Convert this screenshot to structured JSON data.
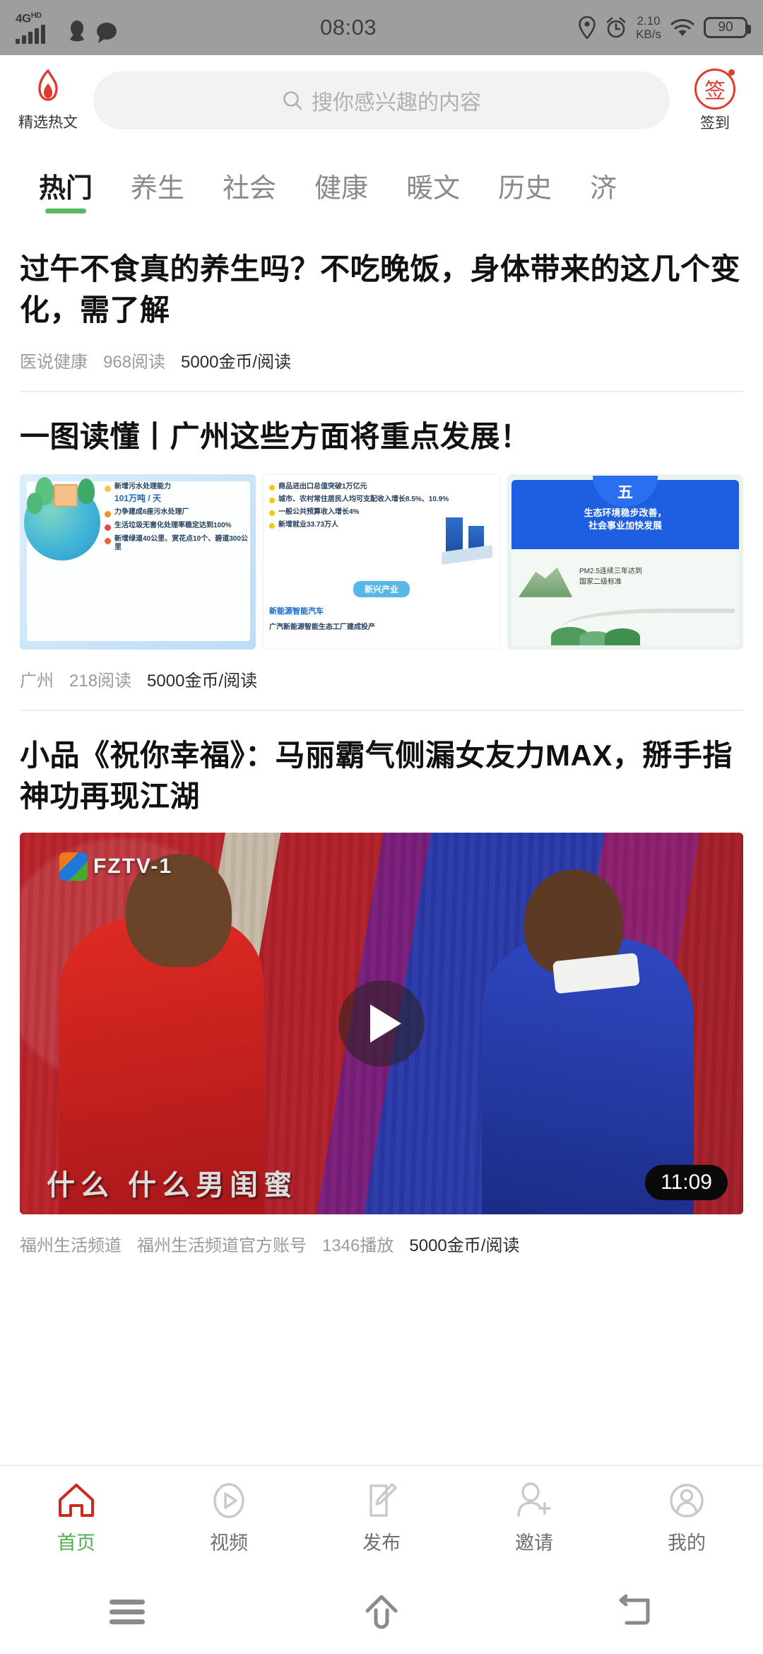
{
  "status_bar": {
    "network_type": "4G",
    "network_suffix": "HD",
    "signal_icon": "signal-bars-icon",
    "notification_icons": [
      "qq-penguin-icon",
      "message-bubble-icon"
    ],
    "time": "08:03",
    "location_icon": "location-pin-icon",
    "alarm_icon": "alarm-clock-icon",
    "net_speed_value": "2.10",
    "net_speed_unit": "KB/s",
    "wifi_icon": "wifi-icon",
    "battery_level": "90"
  },
  "app_header": {
    "hot_entry": {
      "icon": "flame-icon",
      "label": "精选热文"
    },
    "search": {
      "icon": "search-icon",
      "placeholder": "搜你感兴趣的内容",
      "value": ""
    },
    "sign_entry": {
      "icon": "sign-stamp-icon",
      "badge_text": "签",
      "label": "签到"
    }
  },
  "category_tabs": {
    "active_index": 0,
    "items": [
      {
        "label": "热门"
      },
      {
        "label": "养生"
      },
      {
        "label": "社会"
      },
      {
        "label": "健康"
      },
      {
        "label": "暖文"
      },
      {
        "label": "历史"
      },
      {
        "label": "济"
      }
    ],
    "indicator_color": "#5cb860"
  },
  "feed": {
    "articles": [
      {
        "title": "过午不食真的养生吗？不吃晚饭，身体带来的这几个变化，需了解",
        "source": "医说健康",
        "reads": "968阅读",
        "coin": "5000金币/阅读",
        "layout": "text-only"
      },
      {
        "title": "一图读懂丨广州这些方面将重点发展！",
        "source": "广州",
        "reads": "218阅读",
        "coin": "5000金币/阅读",
        "layout": "three-images",
        "images": [
          {
            "name": "infographic-environment",
            "bullets": [
              {
                "text_prefix": "新增污水处理能力",
                "highlight": "101万吨 / 天",
                "dot": "#f6c343"
              },
              {
                "text_prefix": "力争建成6座污水处理厂",
                "highlight": "",
                "dot": "#f0912d"
              },
              {
                "text_prefix": "生活垃圾无害化处理率稳定达到100%",
                "highlight": "",
                "dot": "#e8484b"
              },
              {
                "text_prefix": "新增绿道40公里、赏花点10个、碧道300公里",
                "highlight": "",
                "dot": "#ef6233"
              }
            ]
          },
          {
            "name": "infographic-economy",
            "bullets": [
              "商品进出口总值突破1万亿元",
              "城市、农村常住居民人均可支配收入增长8.5%、10.9%",
              "一般公共预算收入增长4%",
              "新增就业33.73万人"
            ],
            "section_pill": "新兴产业",
            "sub_heading": "新能源智能汽车",
            "sub_bullet": "广汽新能源智能生态工厂建成投产"
          },
          {
            "name": "infographic-ecology",
            "chapter_number": "五",
            "headline_line1": "生态环境稳步改善，",
            "headline_line2": "社会事业加快发展",
            "body_line1": "PM2.5连续三年达到",
            "body_line2": "国家二级标准"
          }
        ]
      },
      {
        "title": "小品《祝你幸福》：马丽霸气侧漏女友力MAX，掰手指神功再现江湖",
        "source": "福州生活频道",
        "account": "福州生活频道官方账号",
        "plays": "1346播放",
        "coin": "5000金币/阅读",
        "layout": "video",
        "video": {
          "channel_watermark": "FZTV-1",
          "burned_subtitle": "什么 什么男闺蜜",
          "duration": "11:09",
          "play_icon": "play-button-icon"
        }
      }
    ]
  },
  "bottom_nav": {
    "active_index": 0,
    "active_color": "#4caf50",
    "active_icon_color": "#cc2b1f",
    "items": [
      {
        "label": "首页",
        "icon": "home-icon"
      },
      {
        "label": "视频",
        "icon": "play-circle-icon"
      },
      {
        "label": "发布",
        "icon": "compose-pencil-icon"
      },
      {
        "label": "邀请",
        "icon": "user-plus-icon"
      },
      {
        "label": "我的",
        "icon": "user-circle-icon"
      }
    ]
  },
  "android_nav": {
    "items": [
      {
        "name": "recents-button",
        "icon": "hamburger-icon"
      },
      {
        "name": "home-button",
        "icon": "home-arrow-icon"
      },
      {
        "name": "back-button",
        "icon": "back-arrow-icon"
      }
    ]
  }
}
